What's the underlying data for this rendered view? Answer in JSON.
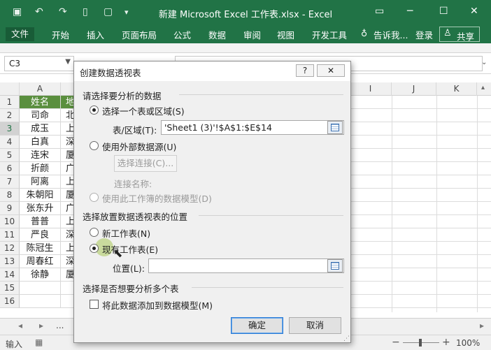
{
  "window": {
    "title": "新建 Microsoft Excel 工作表.xlsx - Excel",
    "minimize": "─",
    "restore": "☐",
    "close": "✕",
    "options": "▭"
  },
  "ribbon": {
    "tabs": [
      "文件",
      "开始",
      "插入",
      "页面布局",
      "公式",
      "数据",
      "审阅",
      "视图",
      "开发工具"
    ],
    "tell_me": "告诉我...",
    "login": "登录",
    "share": "共享"
  },
  "formula": {
    "namebox": "C3"
  },
  "grid": {
    "columns": [
      "A",
      "I",
      "J",
      "K"
    ],
    "rows": [
      "1",
      "2",
      "3",
      "4",
      "5",
      "6",
      "7",
      "8",
      "9",
      "10",
      "11",
      "12",
      "13",
      "14",
      "15",
      "16"
    ],
    "colA": [
      "姓名",
      "司命",
      "成玉",
      "白真",
      "连宋",
      "折颜",
      "阿离",
      "朱朝阳",
      "张东升",
      "普普",
      "严良",
      "陈冠生",
      "周春红",
      "徐静",
      "",
      ""
    ],
    "colB": [
      "地",
      "北",
      "上",
      "深",
      "厦",
      "广",
      "上",
      "厦",
      "广",
      "上",
      "深",
      "上",
      "深",
      "厦",
      "",
      ""
    ]
  },
  "sheetbar": {
    "prev": "◂",
    "next": "▸",
    "more": "...",
    "scroll_right": "▸"
  },
  "status": {
    "mode": "输入",
    "zoom": "100%",
    "zoom_minus": "−",
    "zoom_plus": "+"
  },
  "dialog": {
    "title": "创建数据透视表",
    "help": "?",
    "close": "✕",
    "section1": "请选择要分析的数据",
    "opt_table": "选择一个表或区域(S)",
    "table_range_label": "表/区域(T):",
    "table_range_value": "'Sheet1 (3)'!$A$1:$E$14",
    "opt_external": "使用外部数据源(U)",
    "choose_connection": "选择连接(C)...",
    "connection_name_label": "连接名称:",
    "opt_data_model": "使用此工作簿的数据模型(D)",
    "section2": "选择放置数据透视表的位置",
    "opt_new_sheet": "新工作表(N)",
    "opt_existing_sheet": "现有工作表(E)",
    "location_label": "位置(L):",
    "location_value": "",
    "section3": "选择是否想要分析多个表",
    "add_to_model": "将此数据添加到数据模型(M)",
    "ok": "确定",
    "cancel": "取消"
  }
}
